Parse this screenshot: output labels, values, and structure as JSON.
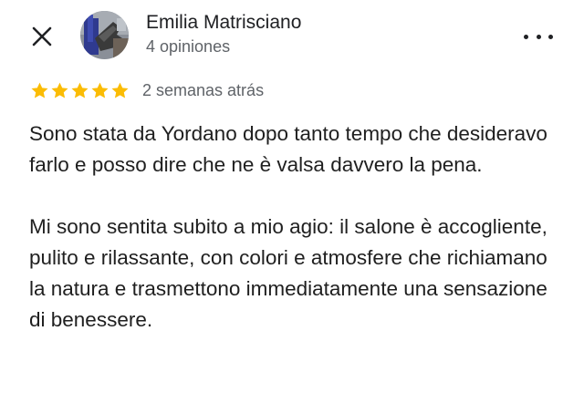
{
  "header": {
    "close_icon": "close-icon",
    "avatar_icon": "avatar",
    "reviewer_name": "Emilia Matrisciano",
    "review_count": "4 opiniones",
    "more_icon": "more-vert-icon"
  },
  "rating": {
    "stars": 5,
    "max_stars": 5,
    "star_color": "#fbbc04",
    "date": "2 semanas atrás"
  },
  "review": {
    "paragraphs": [
      "Sono stata da Yordano dopo tanto tempo che desideravo farlo e posso dire che ne è valsa davvero la pena.",
      "Mi sono sentita subito a mio agio: il salone è accogliente, pulito e rilassante, con colori e atmosfere che richiamano la natura e trasmettono immediatamente una sensazione di benessere."
    ]
  }
}
